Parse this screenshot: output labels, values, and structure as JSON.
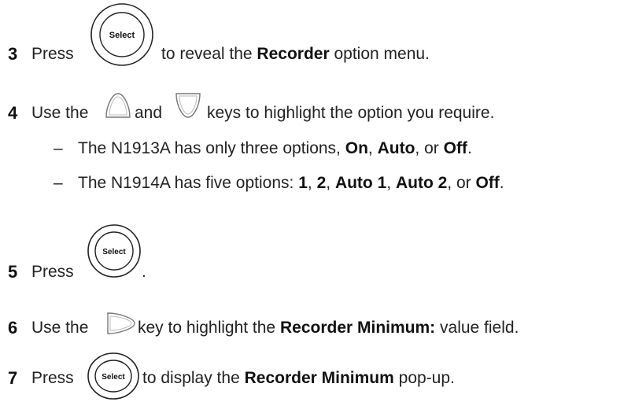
{
  "keys": {
    "select_label": "Select"
  },
  "steps": [
    {
      "number": "3",
      "pre": "Press",
      "mid": "to reveal the",
      "bold": "Recorder",
      "post": "option menu."
    },
    {
      "number": "4",
      "pre": "Use the",
      "and": "and",
      "post": "keys to highlight the option you require.",
      "bullets": [
        {
          "dash": "–",
          "text": "The N1913A has only three options,",
          "opts": [
            "On",
            "Auto",
            "Off"
          ],
          "sep1": ",",
          "sep2": ", or",
          "end": "."
        },
        {
          "dash": "–",
          "text": "The N1914A has five options:",
          "opts": [
            "1",
            "2",
            "Auto 1",
            "Auto 2",
            "Off"
          ],
          "sep1": ",",
          "sep2": ",",
          "sep3": ",",
          "sep4": ", or",
          "end": "."
        }
      ]
    },
    {
      "number": "5",
      "pre": "Press",
      "post": "."
    },
    {
      "number": "6",
      "pre": "Use the",
      "mid": "key to highlight the",
      "bold": "Recorder Minimum:",
      "post": "value field."
    },
    {
      "number": "7",
      "pre": "Press",
      "mid": "to display the",
      "bold": "Recorder Minimum",
      "post": "pop-up."
    }
  ]
}
